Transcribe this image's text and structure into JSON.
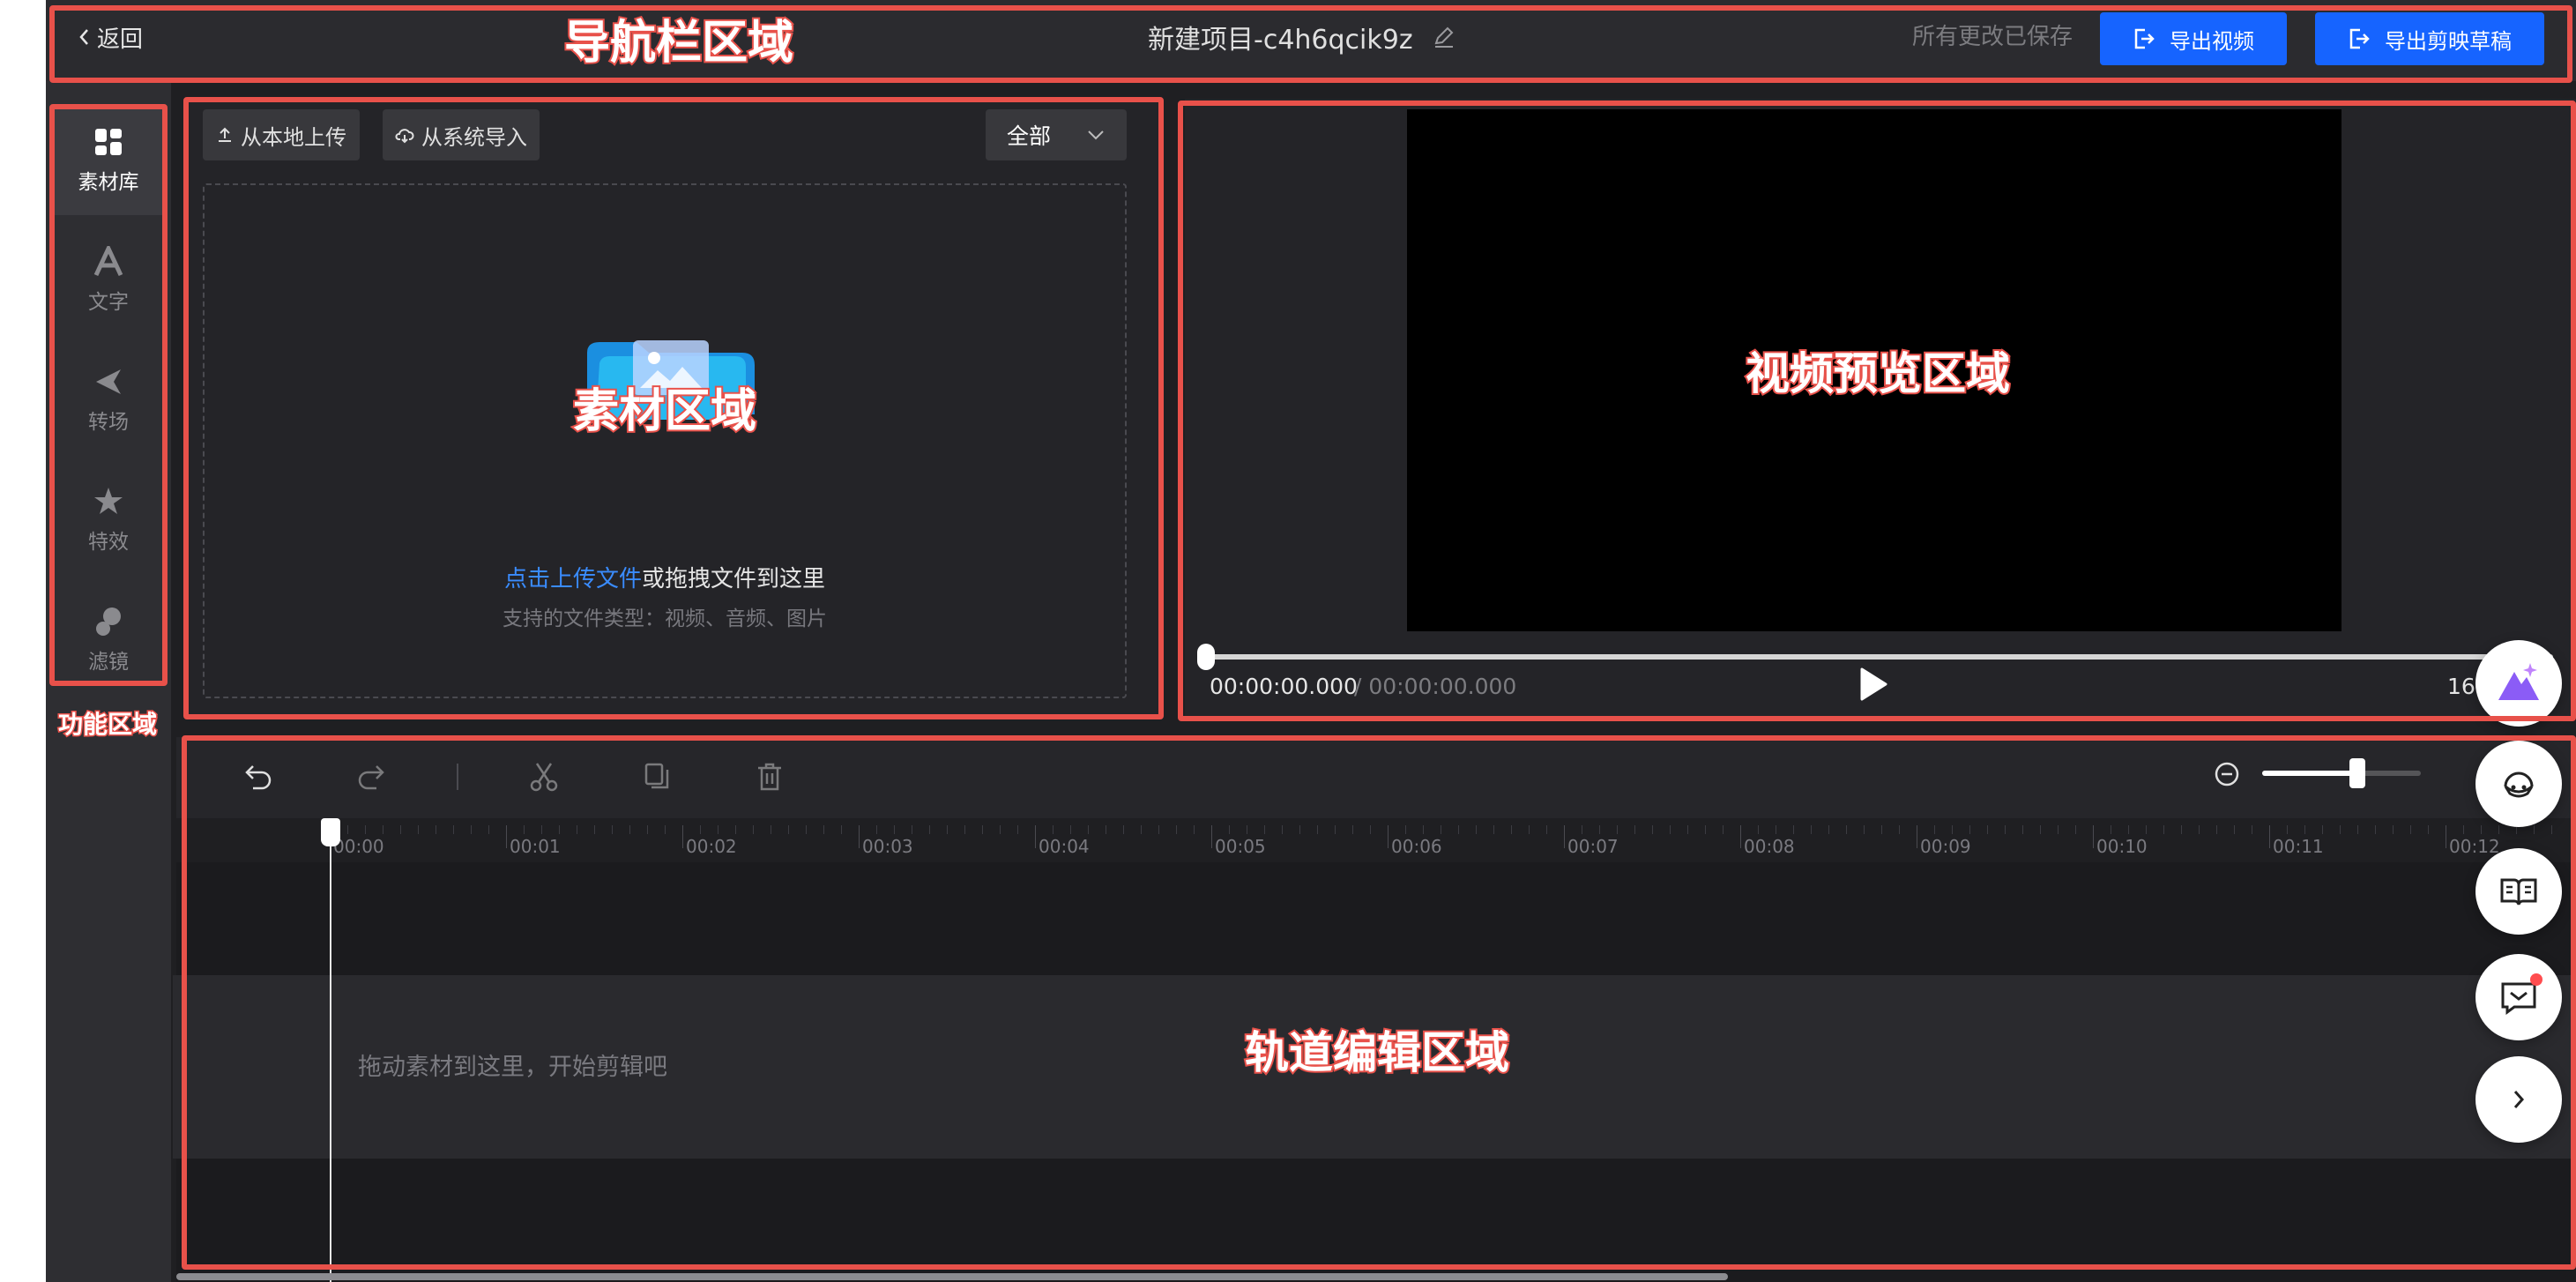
{
  "nav": {
    "back_label": "返回",
    "project_title": "新建项目-c4h6qcik9z",
    "saved_status": "所有更改已保存",
    "export_video_label": "导出视频",
    "export_draft_label": "导出剪映草稿"
  },
  "sidebar": {
    "items": [
      {
        "label": "素材库",
        "icon": "grid-icon",
        "active": true
      },
      {
        "label": "文字",
        "icon": "text-icon",
        "active": false
      },
      {
        "label": "转场",
        "icon": "transition-icon",
        "active": false
      },
      {
        "label": "特效",
        "icon": "star-effect-icon",
        "active": false
      },
      {
        "label": "滤镜",
        "icon": "filter-icon",
        "active": false
      }
    ]
  },
  "material": {
    "upload_local_label": "从本地上传",
    "import_system_label": "从系统导入",
    "filter_value": "全部",
    "upload_link": "点击上传文件",
    "upload_text_rest": "或拖拽文件到这里",
    "upload_hint": "支持的文件类型：视频、音频、图片"
  },
  "preview": {
    "time_current": "00:00:00.000",
    "time_total": "/ 00:00:00.000",
    "aspect_ratio": "16:9",
    "progress": 0
  },
  "timeline": {
    "tick_labels": [
      "00:00",
      "00:01",
      "00:02",
      "00:03",
      "00:04",
      "00:05",
      "00:06",
      "00:07",
      "00:08",
      "00:09",
      "00:10",
      "00:11",
      "00:12"
    ],
    "empty_hint": "拖动素材到这里，开始剪辑吧",
    "zoom_level": 0.6,
    "tools": [
      "undo-icon",
      "redo-icon",
      "cut-icon",
      "copy-icon",
      "delete-icon",
      "zoom-out-icon"
    ]
  },
  "floating": [
    "ai-assistant-icon",
    "customer-service-icon",
    "guide-book-icon",
    "feedback-icon",
    "expand-icon"
  ],
  "annotations": {
    "nav_area": "导航栏区域",
    "material_area": "素材区域",
    "preview_area": "视频预览区域",
    "function_area": "功能区域",
    "track_area": "轨道编辑区域"
  },
  "colors": {
    "accent": "#1664ff",
    "link": "#3a8cff",
    "annotation": "#e8514a",
    "background": "#1f1f22"
  }
}
